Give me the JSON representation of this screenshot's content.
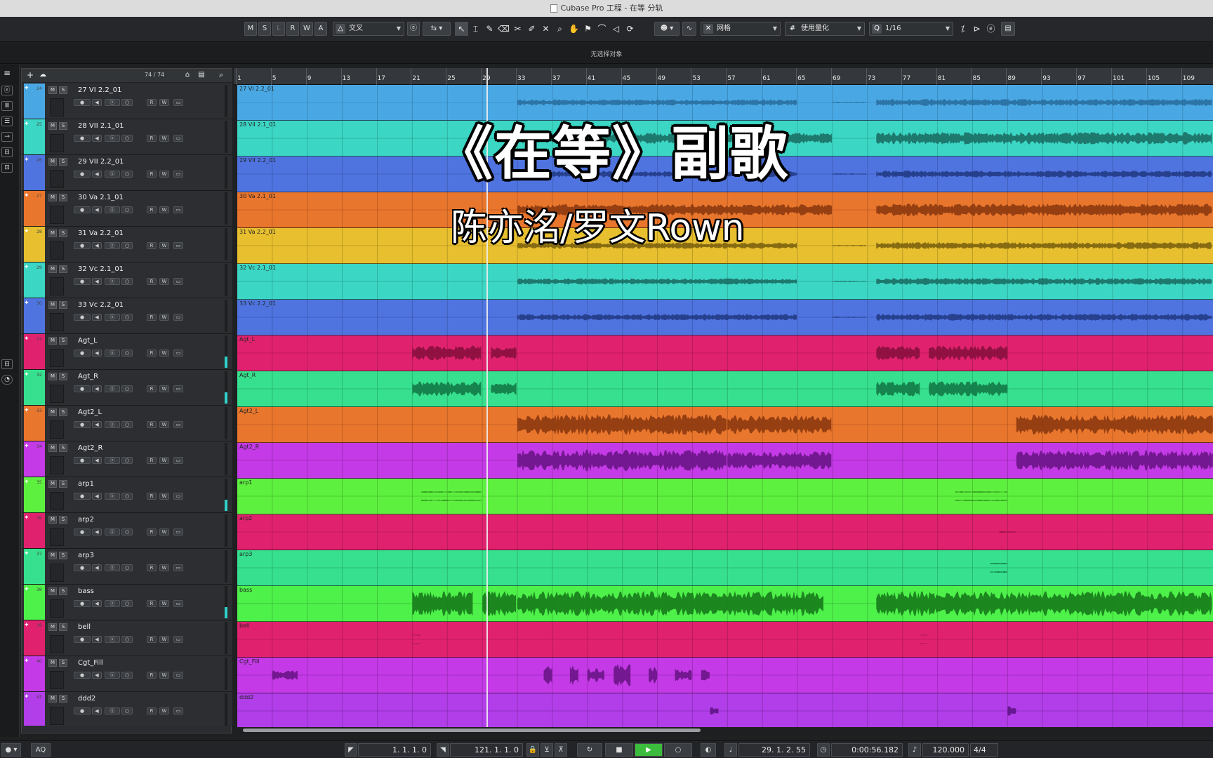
{
  "window": {
    "title": "Cubase Pro 工程 - 在等 分轨"
  },
  "toolbar": {
    "mode_buttons": [
      "M",
      "S",
      "L",
      "R",
      "W",
      "A"
    ],
    "edit_mode": "交叉",
    "snap_type": "网格",
    "quantize_mode": "使用量化",
    "quantize_value": "1/16"
  },
  "info_line": {
    "text": "无选择对象"
  },
  "track_list": {
    "count": "74 / 74"
  },
  "overlay": {
    "title": "《在等》副歌",
    "artist": "陈亦洺/罗文Rown"
  },
  "ruler": {
    "bars": [
      "1",
      "5",
      "9",
      "13",
      "17",
      "21",
      "25",
      "29",
      "33",
      "37",
      "41",
      "45",
      "49",
      "53",
      "57",
      "61",
      "65",
      "69",
      "73",
      "77",
      "81",
      "85",
      "89",
      "93",
      "97",
      "101",
      "105",
      "109"
    ]
  },
  "tracks": [
    {
      "number": "24",
      "name": "27 VI 2.2_01",
      "event": "27 VI 2.2_01",
      "color": "#49a8e4",
      "wave": "#2a6fa0",
      "pattern": "strings_a"
    },
    {
      "number": "25",
      "name": "28 VII 2.1_01",
      "event": "28 VII 2.1_01",
      "color": "#3cd6c4",
      "wave": "#1b6f65",
      "pattern": "strings_b"
    },
    {
      "number": "26",
      "name": "29 VII 2.2_01",
      "event": "29 VII 2.2_01",
      "color": "#4f74e0",
      "wave": "#243c86",
      "pattern": "strings_a"
    },
    {
      "number": "27",
      "name": "30 Va 2.1_01",
      "event": "30 Va 2.1_01",
      "color": "#e9762d",
      "wave": "#8c3a10",
      "pattern": "strings_b"
    },
    {
      "number": "28",
      "name": "31 Va 2.2_01",
      "event": "31 Va 2.2_01",
      "color": "#e7bf2f",
      "wave": "#7d6310",
      "pattern": "strings_a"
    },
    {
      "number": "29",
      "name": "32 Vc 2.1_01",
      "event": "32 Vc 2.1_01",
      "color": "#3cd6c4",
      "wave": "#1b6f65",
      "pattern": "strings_a"
    },
    {
      "number": "30",
      "name": "33 Vc 2.2_01",
      "event": "33 Vc 2.2_01",
      "color": "#4f74e0",
      "wave": "#243c86",
      "pattern": "strings_a"
    },
    {
      "number": "31",
      "name": "Agt_L",
      "event": "Agt_L",
      "color": "#e0226e",
      "wave": "#8a0f3e",
      "pattern": "agt"
    },
    {
      "number": "32",
      "name": "Agt_R",
      "event": "Agt_R",
      "color": "#36e08e",
      "wave": "#137a47",
      "pattern": "agt"
    },
    {
      "number": "33",
      "name": "Agt2_L",
      "event": "Agt2_L",
      "color": "#e9762d",
      "wave": "#8c3a10",
      "pattern": "agt2"
    },
    {
      "number": "34",
      "name": "Agt2_R",
      "event": "Agt2_R",
      "color": "#c43ae6",
      "wave": "#6c1587",
      "pattern": "agt2"
    },
    {
      "number": "35",
      "name": "arp1",
      "event": "arp1",
      "color": "#5ef03f",
      "wave": "#2a8a18",
      "pattern": "arp1"
    },
    {
      "number": "36",
      "name": "arp2",
      "event": "arp2",
      "color": "#e0226e",
      "wave": "#8a0f3e",
      "pattern": "arp2"
    },
    {
      "number": "37",
      "name": "arp3",
      "event": "arp3",
      "color": "#36e08e",
      "wave": "#137a47",
      "pattern": "arp3"
    },
    {
      "number": "38",
      "name": "bass",
      "event": "bass",
      "color": "#4ef04a",
      "wave": "#177a1b",
      "pattern": "bass"
    },
    {
      "number": "39",
      "name": "bell",
      "event": "bell",
      "color": "#e0226e",
      "wave": "#8a0f3e",
      "pattern": "bell"
    },
    {
      "number": "40",
      "name": "Cgt_Fill",
      "event": "Cgt_Fill",
      "color": "#c43ae6",
      "wave": "#6c1587",
      "pattern": "cgt"
    },
    {
      "number": "41",
      "name": "ddd2",
      "event": "ddd2",
      "color": "#b13ee8",
      "wave": "#5e1587",
      "pattern": "ddd"
    }
  ],
  "transport": {
    "left_locator": "1. 1. 1.   0",
    "right_locator": "121. 1. 1.   0",
    "position_bars": "29. 1. 2. 55",
    "position_time": "0:00:56.182",
    "tempo": "120.000",
    "signature": "4/4",
    "aq": "AQ"
  }
}
